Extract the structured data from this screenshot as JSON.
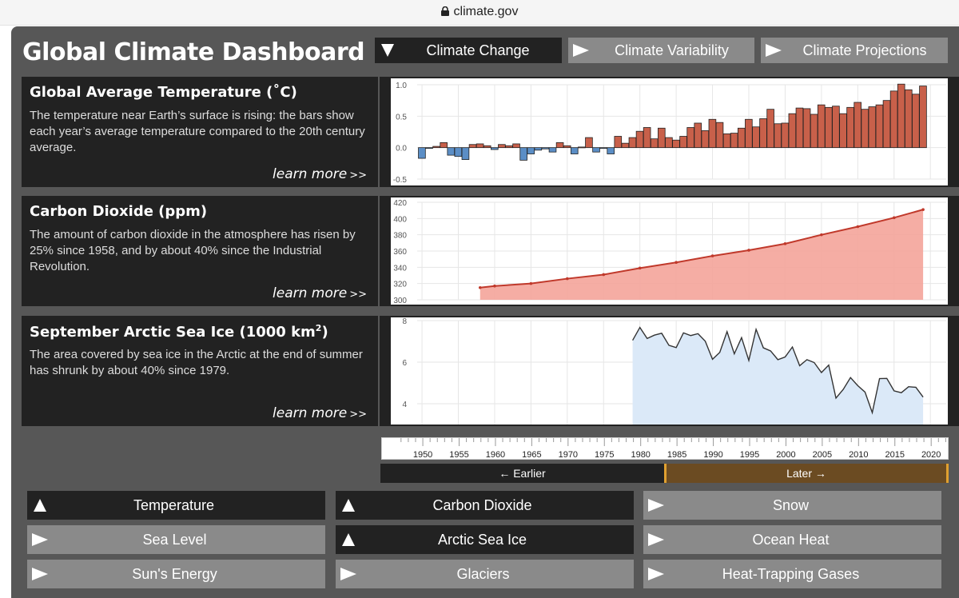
{
  "browser": {
    "url": "climate.gov"
  },
  "dashboard": {
    "title": "Global Climate Dashboard",
    "tabs": [
      {
        "label": "Climate Change",
        "active": true
      },
      {
        "label": "Climate Variability",
        "active": false
      },
      {
        "label": "Climate Projections",
        "active": false
      }
    ],
    "panels": [
      {
        "title": "Global Average Temperature (˚C)",
        "description": "The temperature near Earth’s surface is rising: the bars show each year’s average temperature compared to the 20th century average.",
        "learn_more": "learn more",
        "learn_more_arrow": ">>"
      },
      {
        "title": "Carbon Dioxide (ppm)",
        "description": "The amount of carbon dioxide in the atmosphere has risen by 25% since 1958, and by about 40% since the Industrial Revolution.",
        "learn_more": "learn more",
        "learn_more_arrow": ">>"
      },
      {
        "title_main": "September Arctic Sea Ice (1000 km",
        "title_sup": "2",
        "title_end": ")",
        "description": "The area covered by sea ice in the Arctic at the end of summer has shrunk by about 40% since 1979.",
        "learn_more": "learn more",
        "learn_more_arrow": ">>"
      }
    ],
    "timeline": {
      "ticks": [
        "1950",
        "1955",
        "1960",
        "1965",
        "1970",
        "1975",
        "1980",
        "1985",
        "1990",
        "1995",
        "2000",
        "2005",
        "2010",
        "2015",
        "2020"
      ],
      "earlier": "← Earlier",
      "later": "Later →"
    },
    "buttons": [
      {
        "label": "Temperature",
        "on": true
      },
      {
        "label": "Carbon Dioxide",
        "on": true
      },
      {
        "label": "Snow",
        "on": false
      },
      {
        "label": "Sea Level",
        "on": false
      },
      {
        "label": "Arctic Sea Ice",
        "on": true
      },
      {
        "label": "Ocean Heat",
        "on": false
      },
      {
        "label": "Sun's Energy",
        "on": false
      },
      {
        "label": "Glaciers",
        "on": false
      },
      {
        "label": "Heat-Trapping Gases",
        "on": false
      }
    ],
    "colors": {
      "warm_bar": "#c8604a",
      "cool_bar": "#5b8ec6",
      "co2_fill": "#f4a49a",
      "co2_line": "#c0392b",
      "ice_fill": "#dbe9f8",
      "ice_line": "#333333",
      "later_bar": "#6b4b22"
    }
  },
  "chart_data": [
    {
      "type": "bar",
      "ylim": [
        -0.5,
        1.0
      ],
      "yticks": [
        "1.0",
        "0.5",
        "0.0",
        "-0.5"
      ],
      "x_start": 1950,
      "x": [
        1950,
        1951,
        1952,
        1953,
        1954,
        1955,
        1956,
        1957,
        1958,
        1959,
        1960,
        1961,
        1962,
        1963,
        1964,
        1965,
        1966,
        1967,
        1968,
        1969,
        1970,
        1971,
        1972,
        1973,
        1974,
        1975,
        1976,
        1977,
        1978,
        1979,
        1980,
        1981,
        1982,
        1983,
        1984,
        1985,
        1986,
        1987,
        1988,
        1989,
        1990,
        1991,
        1992,
        1993,
        1994,
        1995,
        1996,
        1997,
        1998,
        1999,
        2000,
        2001,
        2002,
        2003,
        2004,
        2005,
        2006,
        2007,
        2008,
        2009,
        2010,
        2011,
        2012,
        2013,
        2014,
        2015,
        2016,
        2017,
        2018,
        2019
      ],
      "values": [
        -0.17,
        -0.01,
        0.02,
        0.08,
        -0.12,
        -0.14,
        -0.19,
        0.05,
        0.06,
        0.03,
        -0.03,
        0.05,
        0.03,
        0.06,
        -0.2,
        -0.1,
        -0.04,
        -0.02,
        -0.07,
        0.08,
        0.03,
        -0.1,
        0.01,
        0.16,
        -0.07,
        -0.01,
        -0.1,
        0.18,
        0.07,
        0.16,
        0.26,
        0.32,
        0.14,
        0.31,
        0.16,
        0.12,
        0.18,
        0.32,
        0.39,
        0.27,
        0.45,
        0.4,
        0.22,
        0.23,
        0.31,
        0.45,
        0.33,
        0.46,
        0.61,
        0.38,
        0.39,
        0.54,
        0.63,
        0.62,
        0.53,
        0.68,
        0.64,
        0.66,
        0.54,
        0.64,
        0.72,
        0.61,
        0.65,
        0.68,
        0.75,
        0.9,
        1.01,
        0.92,
        0.85,
        0.98
      ]
    },
    {
      "type": "area",
      "ylim": [
        300,
        420
      ],
      "yticks": [
        "420",
        "400",
        "380",
        "360",
        "340",
        "320",
        "300"
      ],
      "x": [
        1958,
        1960,
        1965,
        1970,
        1975,
        1980,
        1985,
        1990,
        1995,
        2000,
        2005,
        2010,
        2015,
        2019
      ],
      "values": [
        315,
        317,
        320,
        326,
        331,
        339,
        346,
        354,
        361,
        369,
        380,
        390,
        401,
        411
      ]
    },
    {
      "type": "area",
      "ylim": [
        3,
        8
      ],
      "yticks": [
        "8",
        "6",
        "4"
      ],
      "x": [
        1979,
        1980,
        1981,
        1982,
        1983,
        1984,
        1985,
        1986,
        1987,
        1988,
        1989,
        1990,
        1991,
        1992,
        1993,
        1994,
        1995,
        1996,
        1997,
        1998,
        1999,
        2000,
        2001,
        2002,
        2003,
        2004,
        2005,
        2006,
        2007,
        2008,
        2009,
        2010,
        2011,
        2012,
        2013,
        2014,
        2015,
        2016,
        2017,
        2018,
        2019
      ],
      "values": [
        7.05,
        7.67,
        7.14,
        7.3,
        7.39,
        6.81,
        6.7,
        7.41,
        7.28,
        7.37,
        7.01,
        6.14,
        6.47,
        7.47,
        6.4,
        7.18,
        6.08,
        7.58,
        6.69,
        6.54,
        6.12,
        6.25,
        6.73,
        5.83,
        6.12,
        5.98,
        5.5,
        5.86,
        4.27,
        4.69,
        5.26,
        4.87,
        4.56,
        3.57,
        5.21,
        5.22,
        4.62,
        4.53,
        4.82,
        4.79,
        4.32
      ]
    }
  ]
}
